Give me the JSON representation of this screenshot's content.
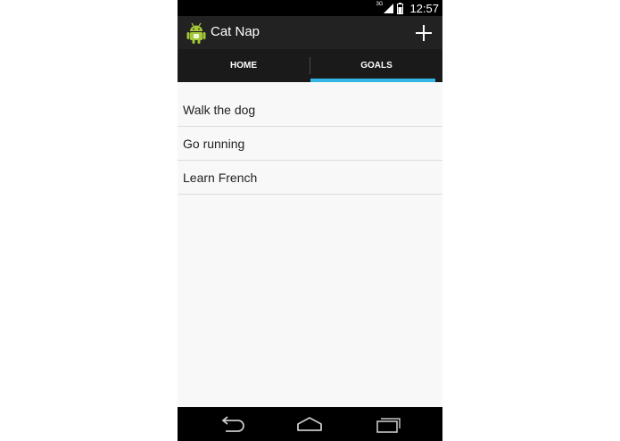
{
  "status_bar": {
    "network_type": "3G",
    "time": "12:57"
  },
  "action_bar": {
    "title": "Cat Nap",
    "app_icon": "android-robot-icon",
    "add_icon": "plus-icon"
  },
  "tabs": [
    {
      "label": "HOME",
      "selected": false
    },
    {
      "label": "GOALS",
      "selected": true
    }
  ],
  "goals": [
    {
      "text": "Walk the dog"
    },
    {
      "text": "Go running"
    },
    {
      "text": "Learn French"
    }
  ],
  "nav_bar": {
    "back_icon": "back-icon",
    "home_icon": "home-icon",
    "recents_icon": "recents-icon"
  },
  "colors": {
    "status_bar_bg": "#000000",
    "action_bar_bg": "#222222",
    "tab_bar_bg": "#1a1a1a",
    "tab_indicator": "#33b5e5",
    "list_bg": "#f8f8f8",
    "android_green": "#a4c639"
  }
}
